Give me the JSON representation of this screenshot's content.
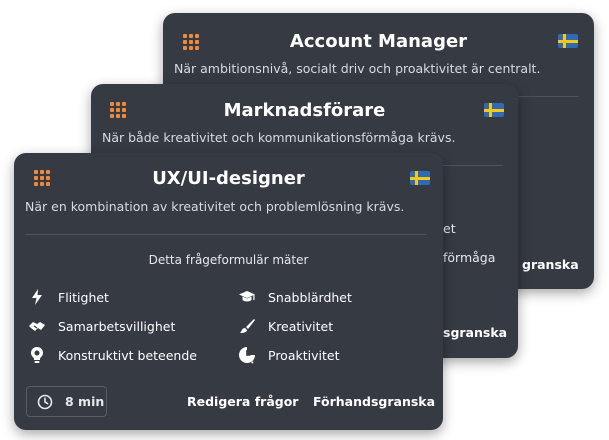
{
  "cards": [
    {
      "title": "Account Manager",
      "subtitle": "När ambitionsnivå, socialt driv och proaktivitet är centralt.",
      "peek": {
        "preview": "granska"
      }
    },
    {
      "title": "Marknadsförare",
      "subtitle": "När både kreativitet och kommunikationsförmåga krävs.",
      "peek": {
        "trait_a": "et",
        "trait_b": "förmåga",
        "preview": "sgranska"
      }
    },
    {
      "title": "UX/UI-designer",
      "subtitle": "När en kombination av kreativitet och problemlösning krävs.",
      "measures_heading": "Detta frågeformulär mäter",
      "traits": [
        {
          "label": "Flitighet",
          "icon": "lightning-icon"
        },
        {
          "label": "Snabblärdhet",
          "icon": "graduation-cap-icon"
        },
        {
          "label": "Samarbetsvillighet",
          "icon": "handshake-icon"
        },
        {
          "label": "Kreativitet",
          "icon": "paintbrush-icon"
        },
        {
          "label": "Konstruktivt beteende",
          "icon": "lightbulb-icon"
        },
        {
          "label": "Proaktivitet",
          "icon": "clock-alert-icon"
        }
      ],
      "duration": "8 min",
      "actions": {
        "edit": "Redigera frågor",
        "preview": "Förhandsgranska"
      }
    }
  ],
  "colors": {
    "card_bg": "#353a43",
    "accent_orange": "#f08a3a",
    "flag_blue": "#2f6ab5",
    "flag_yellow": "#f6c81a"
  },
  "icons": {
    "menu": "grid-icon",
    "language": "swedish-flag-icon",
    "duration": "clock-icon"
  }
}
